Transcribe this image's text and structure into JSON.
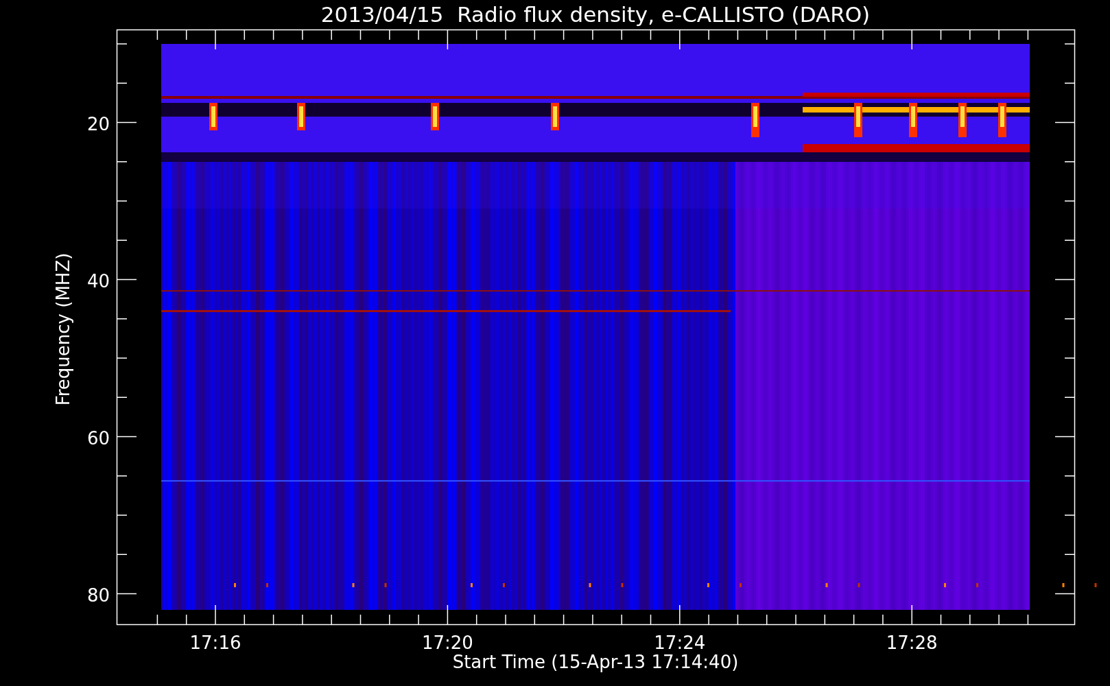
{
  "title": "2013/04/15  Radio flux density, e-CALLISTO (DARO)",
  "y_axis": {
    "label": "Frequency (MHZ)",
    "ticks": [
      "20",
      "40",
      "60",
      "80"
    ]
  },
  "x_axis": {
    "label": "Start Time (15-Apr-13 17:14:40)",
    "ticks": [
      "17:16",
      "17:20",
      "17:24",
      "17:28"
    ]
  }
}
